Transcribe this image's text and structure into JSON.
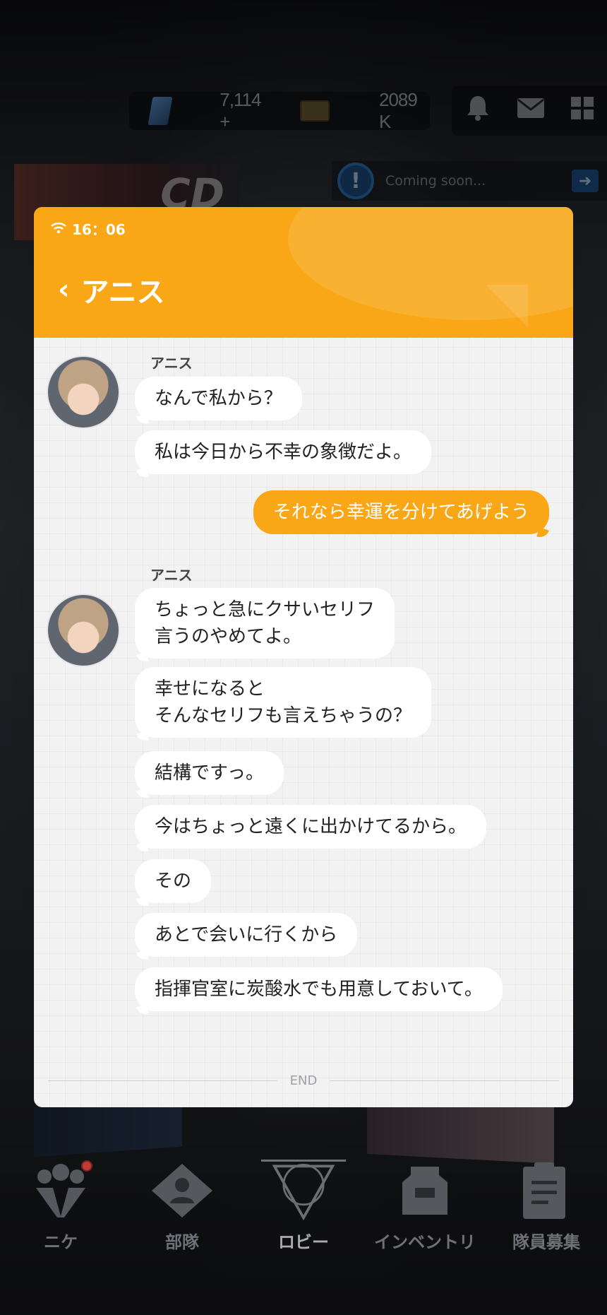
{
  "top_bar": {
    "gems": "7,114 +",
    "credits": "2089 K"
  },
  "notice": {
    "text": "Coming soon..."
  },
  "chat": {
    "status_time": "16：06",
    "title": "アニス",
    "messages": [
      {
        "type": "name",
        "text": "アニス"
      },
      {
        "type": "received",
        "text": "なんで私から？"
      },
      {
        "type": "received",
        "text": "私は今日から不幸の象徴だよ。"
      },
      {
        "type": "sent",
        "text": "それなら幸運を分けてあげよう"
      },
      {
        "type": "name",
        "text": "アニス"
      },
      {
        "type": "received",
        "text": "ちょっと急にクサいセリフ\n言うのやめてよ。"
      },
      {
        "type": "received",
        "text": "幸せになると\nそんなセリフも言えちゃうの？"
      },
      {
        "type": "received",
        "text": "結構ですっ。"
      },
      {
        "type": "received",
        "text": "今はちょっと遠くに出かけてるから。"
      },
      {
        "type": "received",
        "text": "その"
      },
      {
        "type": "received",
        "text": "あとで会いに行くから"
      },
      {
        "type": "received",
        "text": "指揮官室に炭酸水でも用意しておいて。"
      }
    ],
    "end_label": "END"
  },
  "bottom_nav": {
    "items": [
      {
        "label": "ニケ",
        "icon": "nikke-icon"
      },
      {
        "label": "部隊",
        "icon": "squad-icon"
      },
      {
        "label": "ロビー",
        "icon": "lobby-icon"
      },
      {
        "label": "インベントリ",
        "icon": "inventory-icon"
      },
      {
        "label": "隊員募集",
        "icon": "recruit-icon"
      }
    ]
  },
  "colors": {
    "accent": "#f9a716",
    "modal_bg": "#f2f2f3"
  }
}
